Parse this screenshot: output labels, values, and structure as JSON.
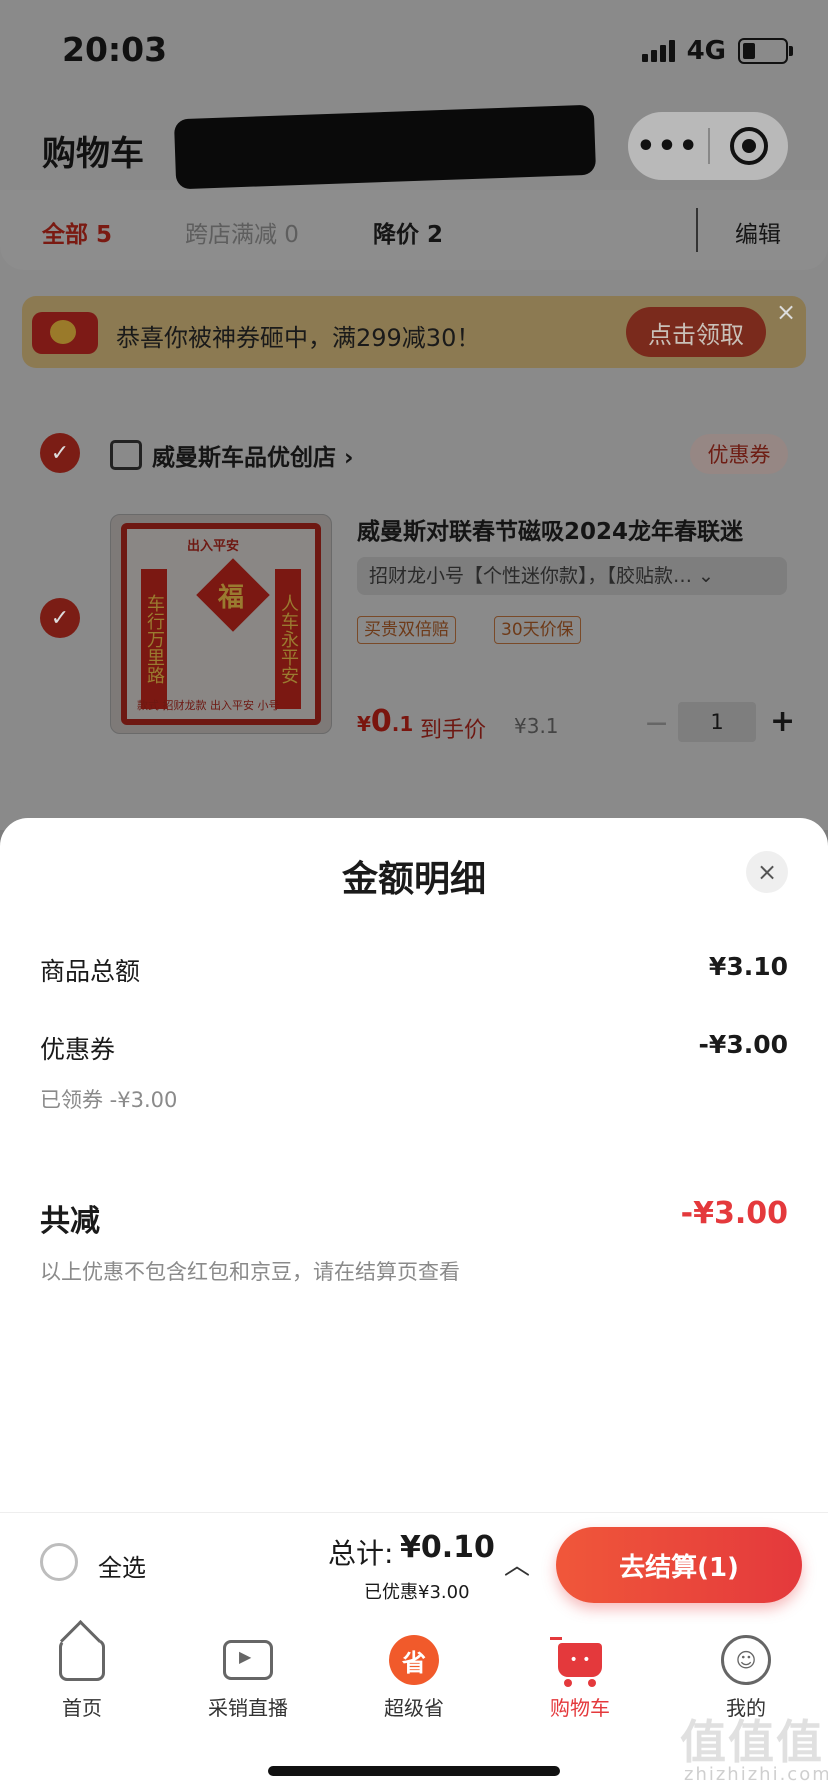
{
  "status_bar": {
    "time": "20:03",
    "network": "4G"
  },
  "header": {
    "title": "购物车"
  },
  "tabs": {
    "all": "全部 5",
    "cross_store": "跨店满减 0",
    "price_drop": "降价 2",
    "edit": "编辑"
  },
  "promo": {
    "text": "恭喜你被神券砸中，满299减30！",
    "button": "点击领取",
    "close": "×"
  },
  "store": {
    "name": "威曼斯车品优创店",
    "chevron": "›",
    "coupon_tag": "优惠券"
  },
  "item": {
    "title": "威曼斯对联春节磁吸2024龙年春联迷",
    "sku": "招财龙小号【个性迷你款】，【胶贴款… ⌄",
    "services": [
      "买贵双倍赔",
      "30天价保"
    ],
    "price_symbol": "¥",
    "price_int": "0",
    "price_dec": ".1",
    "price_label": "到手价",
    "original_price": "¥3.1",
    "qty_minus": "−",
    "qty": "1",
    "qty_plus": "+",
    "thumb": {
      "top": "出入平安",
      "fu": "福",
      "left_col": "车行万里路",
      "right_col": "人车永平安",
      "bottom": "款式 招财龙款 出入平安  小号"
    }
  },
  "sheet": {
    "title": "金额明细",
    "close": "×",
    "rows": [
      {
        "label": "商品总额",
        "value": "¥3.10"
      },
      {
        "label": "优惠券",
        "value": "-¥3.00"
      }
    ],
    "coupon_sub": "已领券 -¥3.00",
    "total_label": "共减",
    "total_value": "-¥3.00",
    "note": "以上优惠不包含红包和京豆，请在结算页查看"
  },
  "settle": {
    "select_all": "全选",
    "sum_label": "总计:",
    "sum_value": "¥0.10",
    "saved": "已优惠¥3.00",
    "chevron": "︿",
    "checkout": "去结算(1)"
  },
  "nav": [
    {
      "label": "首页",
      "icon": "home-icon"
    },
    {
      "label": "采销直播",
      "icon": "live-icon"
    },
    {
      "label": "超级省",
      "icon": "super-save-icon",
      "glyph": "省"
    },
    {
      "label": "购物车",
      "icon": "cart-icon",
      "active": true
    },
    {
      "label": "我的",
      "icon": "me-icon",
      "glyph": "☺"
    }
  ],
  "watermark": {
    "main": "值值值",
    "sub": "zhizhizhi.com"
  },
  "colors": {
    "accent": "#e4393c",
    "checkout_start": "#f0573a"
  }
}
